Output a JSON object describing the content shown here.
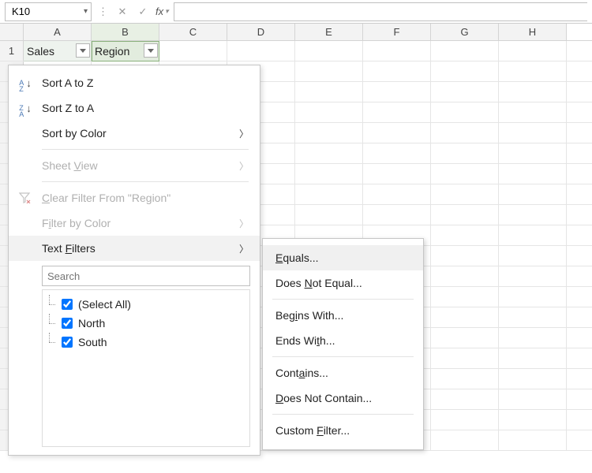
{
  "formula_bar": {
    "name_box": "K10",
    "fx_label": "fx"
  },
  "columns": [
    "A",
    "B",
    "C",
    "D",
    "E",
    "F",
    "G",
    "H"
  ],
  "row1_number": "1",
  "headers": {
    "a": "Sales",
    "b": "Region"
  },
  "menu": {
    "sort_az": "Sort A to Z",
    "sort_za": "Sort Z to A",
    "sort_color": "Sort by Color",
    "sheet_view_pre": "Sheet ",
    "sheet_view_u": "V",
    "sheet_view_post": "iew",
    "clear_pre": "",
    "clear_u": "C",
    "clear_post": "lear Filter From \"Region\"",
    "filter_color_pre": "F",
    "filter_color_u": "i",
    "filter_color_post": "lter by Color",
    "text_filters_pre": "Text ",
    "text_filters_u": "F",
    "text_filters_post": "ilters",
    "search_placeholder": "Search"
  },
  "tree": {
    "select_all": "(Select All)",
    "items": [
      "North",
      "South"
    ]
  },
  "submenu": {
    "equals_u": "E",
    "equals_post": "quals...",
    "dne_pre": "Does ",
    "dne_u": "N",
    "dne_post": "ot Equal...",
    "begins_pre": "Beg",
    "begins_u": "i",
    "begins_post": "ns With...",
    "ends_pre": "Ends Wi",
    "ends_u": "t",
    "ends_post": "h...",
    "contains_pre": "Cont",
    "contains_u": "a",
    "contains_post": "ins...",
    "dnc_pre": "",
    "dnc_u": "D",
    "dnc_post": "oes Not Contain...",
    "custom_pre": "Custom ",
    "custom_u": "F",
    "custom_post": "ilter..."
  }
}
